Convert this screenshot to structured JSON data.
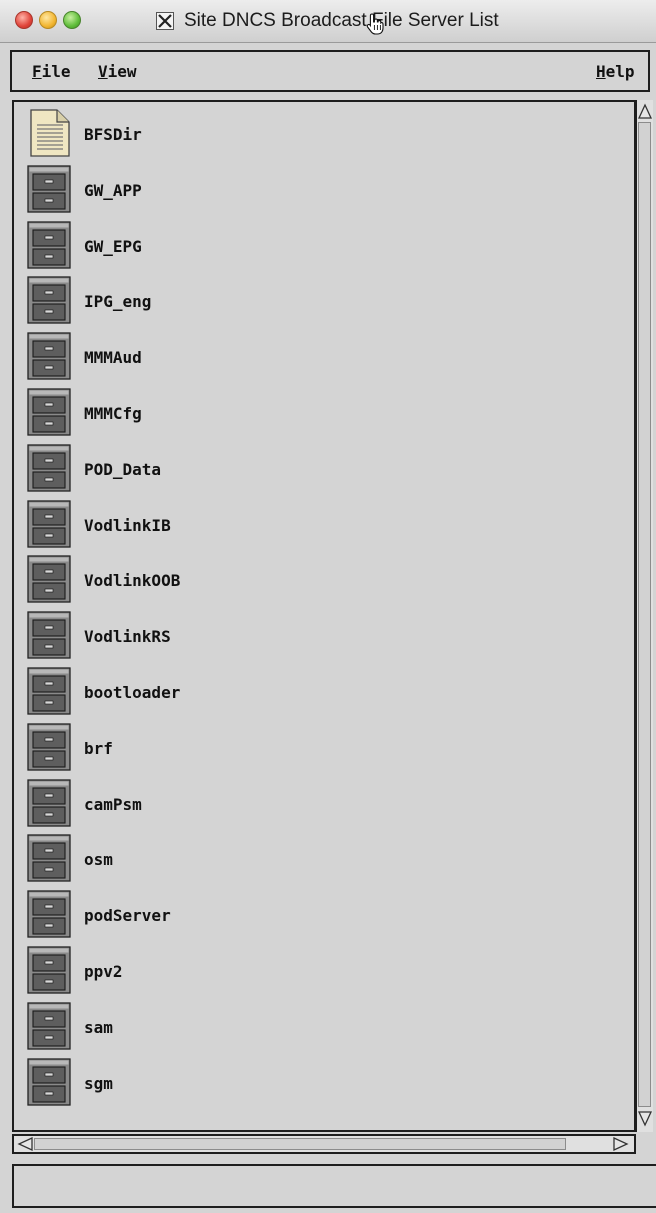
{
  "window": {
    "title": "Site DNCS Broadcast File Server List"
  },
  "menubar": {
    "file": {
      "label_first": "F",
      "label_rest": "ile"
    },
    "view": {
      "label_first": "V",
      "label_rest": "iew"
    },
    "help": {
      "label_first": "H",
      "label_rest": "elp"
    }
  },
  "servers": {
    "items": [
      {
        "name": "BFSDir",
        "icon": "document-icon"
      },
      {
        "name": "GW_APP",
        "icon": "file-cabinet-icon"
      },
      {
        "name": "GW_EPG",
        "icon": "file-cabinet-icon"
      },
      {
        "name": "IPG_eng",
        "icon": "file-cabinet-icon"
      },
      {
        "name": "MMMAud",
        "icon": "file-cabinet-icon"
      },
      {
        "name": "MMMCfg",
        "icon": "file-cabinet-icon"
      },
      {
        "name": "POD_Data",
        "icon": "file-cabinet-icon"
      },
      {
        "name": "VodlinkIB",
        "icon": "file-cabinet-icon"
      },
      {
        "name": "VodlinkOOB",
        "icon": "file-cabinet-icon"
      },
      {
        "name": "VodlinkRS",
        "icon": "file-cabinet-icon"
      },
      {
        "name": "bootloader",
        "icon": "file-cabinet-icon"
      },
      {
        "name": "brf",
        "icon": "file-cabinet-icon"
      },
      {
        "name": "camPsm",
        "icon": "file-cabinet-icon"
      },
      {
        "name": "osm",
        "icon": "file-cabinet-icon"
      },
      {
        "name": "podServer",
        "icon": "file-cabinet-icon"
      },
      {
        "name": "ppv2",
        "icon": "file-cabinet-icon"
      },
      {
        "name": "sam",
        "icon": "file-cabinet-icon"
      },
      {
        "name": "sgm",
        "icon": "file-cabinet-icon"
      }
    ]
  },
  "statusbar": {
    "message": ""
  }
}
